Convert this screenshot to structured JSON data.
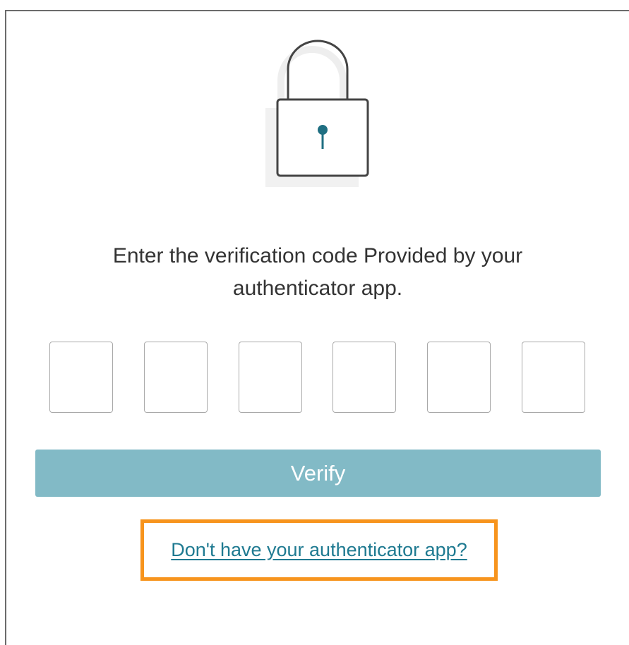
{
  "prompt": {
    "line1": "Enter the verification code Provided by your",
    "line2": "authenticator app."
  },
  "code_inputs": [
    {
      "value": ""
    },
    {
      "value": ""
    },
    {
      "value": ""
    },
    {
      "value": ""
    },
    {
      "value": ""
    },
    {
      "value": ""
    }
  ],
  "verify_button": {
    "label": "Verify"
  },
  "help_link": {
    "label": "Don't have your authenticator app?"
  },
  "icons": {
    "lock": "padlock-icon",
    "keyhole": "keyhole-icon"
  },
  "colors": {
    "accent": "#82bac6",
    "link": "#1f7a91",
    "highlight": "#f7941d",
    "keyhole": "#1f6f82"
  }
}
